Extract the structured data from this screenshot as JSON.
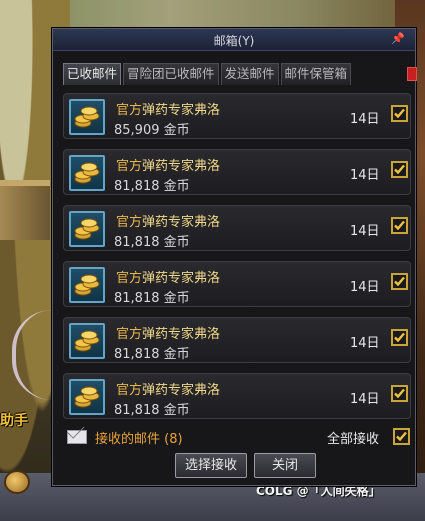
{
  "window": {
    "title": "邮箱(Y)",
    "pin_icon": "pin-icon"
  },
  "tabs": [
    {
      "label": "已收邮件",
      "active": true
    },
    {
      "label": "冒险团已收邮件",
      "active": false
    },
    {
      "label": "发送邮件",
      "active": false
    },
    {
      "label": "邮件保管箱",
      "active": false
    }
  ],
  "mails": [
    {
      "tag": "官方",
      "sender": "弹药专家弗洛",
      "amount": "85,909 金币",
      "days": "14日",
      "checked": true,
      "icon": "gold-coins-icon"
    },
    {
      "tag": "官方",
      "sender": "弹药专家弗洛",
      "amount": "81,818 金币",
      "days": "14日",
      "checked": true,
      "icon": "gold-coins-icon"
    },
    {
      "tag": "官方",
      "sender": "弹药专家弗洛",
      "amount": "81,818 金币",
      "days": "14日",
      "checked": true,
      "icon": "gold-coins-icon"
    },
    {
      "tag": "官方",
      "sender": "弹药专家弗洛",
      "amount": "81,818 金币",
      "days": "14日",
      "checked": true,
      "icon": "gold-coins-icon"
    },
    {
      "tag": "官方",
      "sender": "弹药专家弗洛",
      "amount": "81,818 金币",
      "days": "14日",
      "checked": true,
      "icon": "gold-coins-icon"
    },
    {
      "tag": "官方",
      "sender": "弹药专家弗洛",
      "amount": "81,818 金币",
      "days": "14日",
      "checked": true,
      "icon": "gold-coins-icon"
    }
  ],
  "footer": {
    "received_label": "接收的邮件 (8)",
    "select_all_label": "全部接收",
    "select_all_checked": true,
    "receive_button": "选择接收",
    "close_button": "关闭"
  },
  "background": {
    "helper_label": "助手",
    "watermark": "COLG @「人间失格」"
  },
  "colors": {
    "accent_gold": "#e8b84a",
    "received_orange": "#e8a23a",
    "checkbox_border": "#c9a437",
    "title_bar": "#2e3854"
  }
}
